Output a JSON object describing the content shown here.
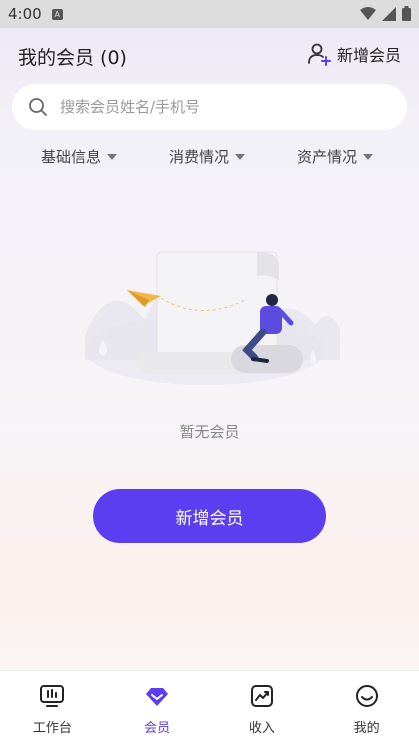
{
  "status_bar": {
    "time": "4:00",
    "notification_badge": "A"
  },
  "header": {
    "title": "我的会员 (0)",
    "add_member_label": "新增会员"
  },
  "search": {
    "placeholder": "搜索会员姓名/手机号",
    "value": ""
  },
  "filters": [
    {
      "label": "基础信息"
    },
    {
      "label": "消费情况"
    },
    {
      "label": "资产情况"
    }
  ],
  "empty_state": {
    "text": "暂无会员",
    "button_label": "新增会员"
  },
  "tabbar": {
    "items": [
      {
        "label": "工作台",
        "icon": "workbench-icon",
        "active": false
      },
      {
        "label": "会员",
        "icon": "member-icon",
        "active": true
      },
      {
        "label": "收入",
        "icon": "income-icon",
        "active": false
      },
      {
        "label": "我的",
        "icon": "profile-icon",
        "active": false
      }
    ]
  },
  "colors": {
    "accent": "#5b3ef0",
    "status_bar": "#dcdcdc",
    "text_muted": "#888888"
  }
}
